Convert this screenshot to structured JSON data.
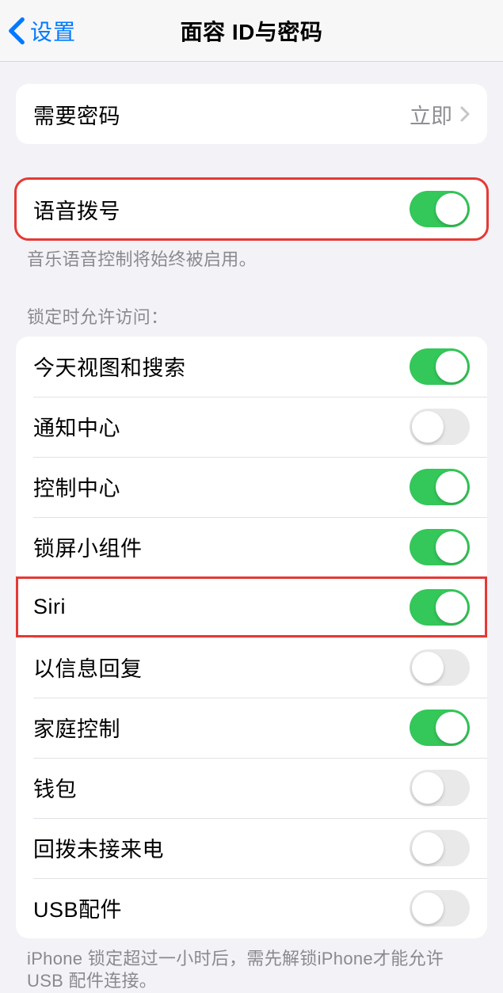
{
  "navbar": {
    "back_label": "设置",
    "title": "面容 ID与密码"
  },
  "require_passcode": {
    "label": "需要密码",
    "value": "立即"
  },
  "voice_dial": {
    "label": "语音拨号",
    "on": true,
    "footer": "音乐语音控制将始终被启用。"
  },
  "lock_access": {
    "header": "锁定时允许访问：",
    "items": [
      {
        "label": "今天视图和搜索",
        "on": true,
        "highlighted": false
      },
      {
        "label": "通知中心",
        "on": false,
        "highlighted": false
      },
      {
        "label": "控制中心",
        "on": true,
        "highlighted": false
      },
      {
        "label": "锁屏小组件",
        "on": true,
        "highlighted": false
      },
      {
        "label": "Siri",
        "on": true,
        "highlighted": true
      },
      {
        "label": "以信息回复",
        "on": false,
        "highlighted": false
      },
      {
        "label": "家庭控制",
        "on": true,
        "highlighted": false
      },
      {
        "label": "钱包",
        "on": false,
        "highlighted": false
      },
      {
        "label": "回拨未接来电",
        "on": false,
        "highlighted": false
      },
      {
        "label": "USB配件",
        "on": false,
        "highlighted": false
      }
    ],
    "footer": "iPhone 锁定超过一小时后，需先解锁iPhone才能允许USB 配件连接。"
  }
}
